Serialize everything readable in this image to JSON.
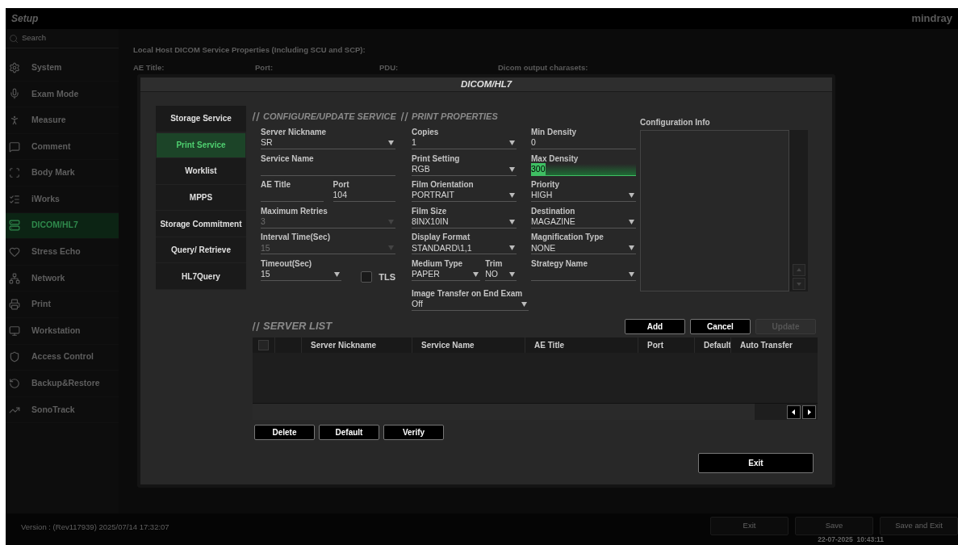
{
  "app": {
    "title": "Setup",
    "logo": "mindray"
  },
  "sidebar": {
    "search_placeholder": "Search",
    "items": [
      {
        "label": "System",
        "selected": false
      },
      {
        "label": "Exam Mode",
        "selected": false
      },
      {
        "label": "Measure",
        "selected": false
      },
      {
        "label": "Comment",
        "selected": false
      },
      {
        "label": "Body Mark",
        "selected": false
      },
      {
        "label": "iWorks",
        "selected": false
      },
      {
        "label": "DICOM/HL7",
        "selected": true
      },
      {
        "label": "Stress Echo",
        "selected": false
      },
      {
        "label": "Network",
        "selected": false
      },
      {
        "label": "Print",
        "selected": false
      },
      {
        "label": "Workstation",
        "selected": false
      },
      {
        "label": "Access Control",
        "selected": false
      },
      {
        "label": "Backup&Restore",
        "selected": false
      },
      {
        "label": "SonoTrack",
        "selected": false
      }
    ]
  },
  "background": {
    "heading": "Local Host DICOM Service Properties (Including SCU and SCP):",
    "labels": [
      "AE Title:",
      "Port:",
      "PDU:",
      "Dicom output charasets:"
    ]
  },
  "dialog": {
    "title": "DICOM/HL7",
    "tabs": [
      {
        "label": "Storage Service",
        "selected": false
      },
      {
        "label": "Print Service",
        "selected": true
      },
      {
        "label": "Worklist",
        "selected": false
      },
      {
        "label": "MPPS",
        "selected": false
      },
      {
        "label": "Storage Commitment",
        "selected": false
      },
      {
        "label": "Query/ Retrieve",
        "selected": false
      },
      {
        "label": "HL7Query",
        "selected": false
      }
    ],
    "configure": {
      "heading": "CONFIGURE/UPDATE SERVICE",
      "rows": [
        [
          {
            "kind": "dropdown",
            "label": "Server Nickname",
            "value": "SR",
            "disabled": false,
            "focused": false
          }
        ],
        [
          {
            "kind": "text",
            "label": "Service Name",
            "disabled": false,
            "focused": false
          }
        ],
        [
          {
            "kind": "text",
            "label": "AE Title",
            "disabled": false,
            "focused": false
          },
          {
            "kind": "text",
            "label": "Port",
            "value": "104",
            "disabled": false,
            "focused": false
          }
        ],
        [
          {
            "kind": "dropdown",
            "label": "Maximum Retries",
            "value": "3",
            "disabled": true,
            "focused": false
          }
        ],
        [
          {
            "kind": "dropdown",
            "label": "Interval Time(Sec)",
            "value": "15",
            "disabled": true,
            "focused": false
          }
        ],
        [
          {
            "kind": "dropdown",
            "label": "Timeout(Sec)",
            "value": "15",
            "disabled": false,
            "focused": false
          },
          {
            "kind": "checkbox",
            "label": "TLS",
            "checked": false
          }
        ]
      ]
    },
    "print": {
      "heading": "PRINT PROPERTIES",
      "column_1": [
        [
          {
            "kind": "dropdown",
            "label": "Copies",
            "value": "1",
            "disabled": false,
            "focused": false
          }
        ],
        [
          {
            "kind": "dropdown",
            "label": "Print Setting",
            "value": "RGB",
            "disabled": false,
            "focused": false
          }
        ],
        [
          {
            "kind": "dropdown",
            "label": "Film Orientation",
            "value": "PORTRAIT",
            "disabled": false,
            "focused": false
          }
        ],
        [
          {
            "kind": "dropdown",
            "label": "Film Size",
            "value": "8INX10IN",
            "disabled": false,
            "focused": false
          }
        ],
        [
          {
            "kind": "dropdown",
            "label": "Display Format",
            "value": "STANDARD\\1,1",
            "disabled": false,
            "focused": false
          }
        ],
        [
          {
            "kind": "dropdown",
            "label": "Medium Type",
            "value": "PAPER",
            "disabled": false,
            "focused": false
          },
          {
            "kind": "dropdown",
            "label": "Trim",
            "value": "NO",
            "disabled": false,
            "focused": false
          }
        ],
        [
          {
            "kind": "dropdown",
            "label": "Image Transfer on End Exam",
            "value": "Off",
            "disabled": false,
            "focused": false
          }
        ]
      ],
      "column_2": [
        [
          {
            "kind": "text",
            "label": "Min Density",
            "value": "0",
            "disabled": false,
            "focused": false
          }
        ],
        [
          {
            "kind": "text",
            "label": "Max Density",
            "value": "300",
            "disabled": false,
            "focused": true
          }
        ],
        [
          {
            "kind": "dropdown",
            "label": "Priority",
            "value": "HIGH",
            "disabled": false,
            "focused": false
          }
        ],
        [
          {
            "kind": "dropdown",
            "label": "Destination",
            "value": "MAGAZINE",
            "disabled": false,
            "focused": false
          }
        ],
        [
          {
            "kind": "dropdown",
            "label": "Magnification Type",
            "value": "NONE",
            "disabled": false,
            "focused": false
          }
        ],
        [
          {
            "kind": "dropdown",
            "label": "Strategy Name",
            "disabled": false,
            "focused": false
          }
        ]
      ]
    },
    "configuration_info": {
      "label": "Configuration Info"
    },
    "server_list": {
      "heading": "SERVER LIST",
      "action_buttons": [
        {
          "label": "Add",
          "disabled": false
        },
        {
          "label": "Cancel",
          "disabled": false
        },
        {
          "label": "Update",
          "disabled": true
        }
      ],
      "select_all_checked": false,
      "columns": [
        "Server Nickname",
        "Service Name",
        "AE Title",
        "Port",
        "Default",
        "Auto Transfer"
      ],
      "buttons": [
        {
          "label": "Delete"
        },
        {
          "label": "Default"
        },
        {
          "label": "Verify"
        }
      ]
    },
    "exit_button": "Exit"
  },
  "footer": {
    "version": "Version : (Rev117939) 2025/07/14 17:32:07",
    "buttons": [
      "Exit",
      "Save",
      "Save and Exit"
    ],
    "datetime": "22-07-2025  10:43:11"
  }
}
